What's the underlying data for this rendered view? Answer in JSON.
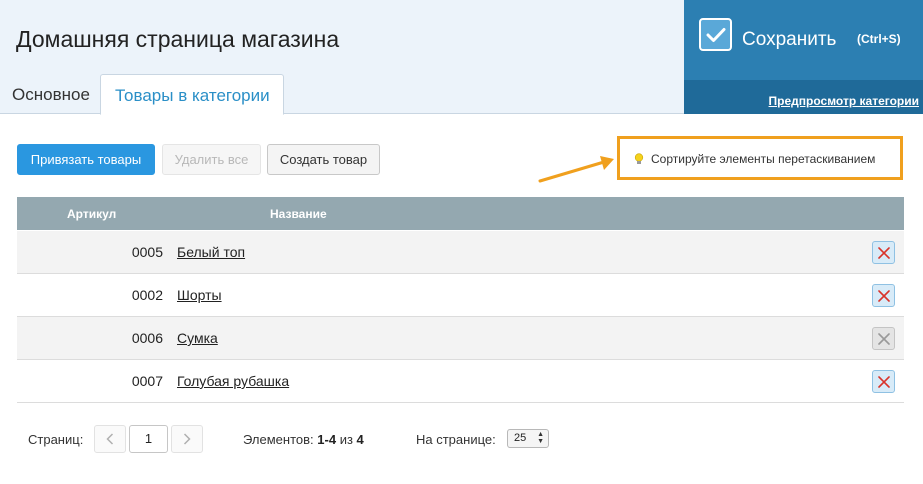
{
  "header": {
    "title": "Домашняя страница магазина",
    "tabs": [
      {
        "label": "Основное"
      },
      {
        "label": "Товары в категории"
      }
    ],
    "save": {
      "label": "Сохранить",
      "hotkey": "(Ctrl+S)"
    },
    "preview_link": "Предпросмотр категории"
  },
  "toolbar": {
    "bind_label": "Привязать товары",
    "delete_all_label": "Удалить все",
    "create_label": "Создать товар"
  },
  "hint": {
    "icon": "lightbulb-icon",
    "text": "Сортируйте элементы перетаскиванием"
  },
  "table": {
    "columns": [
      "Артикул",
      "Название"
    ],
    "rows": [
      {
        "sku": "0005",
        "name": "Белый топ",
        "delete_enabled": true
      },
      {
        "sku": "0002",
        "name": "Шорты",
        "delete_enabled": true
      },
      {
        "sku": "0006",
        "name": "Сумка",
        "delete_enabled": false
      },
      {
        "sku": "0007",
        "name": "Голубая рубашка",
        "delete_enabled": true
      }
    ]
  },
  "pagination": {
    "pages_label": "Страниц:",
    "current_page": "1",
    "items_label": "Элементов:",
    "items_range": "1-4",
    "items_of": "из",
    "items_total": "4",
    "per_page_label": "На странице:",
    "per_page_value": "25"
  },
  "colors": {
    "accent": "#2a97e0",
    "save_panel": "#2c7fb2",
    "hint_border": "#f0a01e",
    "table_header": "#94a8b0",
    "delete_icon": "#d9342b"
  }
}
